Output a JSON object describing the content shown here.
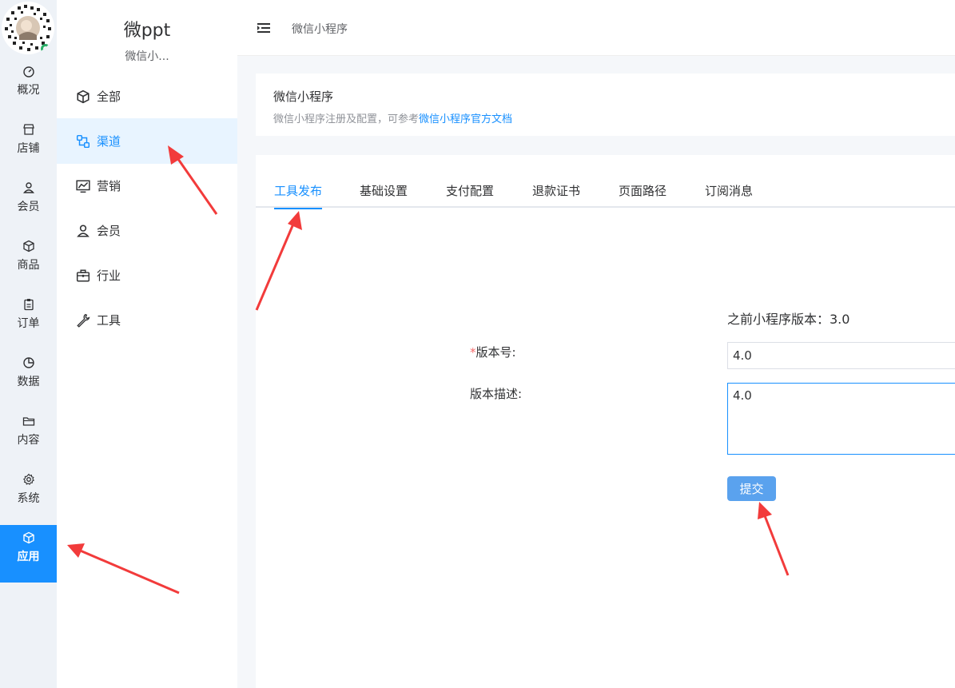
{
  "colors": {
    "accent": "#1890ff",
    "rail_bg": "#eef2f7",
    "active_side_bg": "#e8f4ff",
    "submit_bg": "#5aa2ee",
    "required": "#f56c6c",
    "annotation_arrow": "#f23b3b"
  },
  "rail": {
    "items": [
      {
        "label": "概况",
        "icon": "dashboard-icon"
      },
      {
        "label": "店铺",
        "icon": "store-icon"
      },
      {
        "label": "会员",
        "icon": "user-icon"
      },
      {
        "label": "商品",
        "icon": "box-icon"
      },
      {
        "label": "订单",
        "icon": "clipboard-icon"
      },
      {
        "label": "数据",
        "icon": "pie-chart-icon"
      },
      {
        "label": "内容",
        "icon": "folder-icon"
      },
      {
        "label": "系统",
        "icon": "gear-icon"
      },
      {
        "label": "应用",
        "icon": "cube-icon",
        "active": true
      }
    ]
  },
  "sidebar": {
    "title": "微ppt",
    "subtitle": "微信小...",
    "items": [
      {
        "label": "全部",
        "icon": "cube-icon"
      },
      {
        "label": "渠道",
        "icon": "channel-icon",
        "active": true
      },
      {
        "label": "营销",
        "icon": "trend-chart-icon"
      },
      {
        "label": "会员",
        "icon": "user-icon"
      },
      {
        "label": "行业",
        "icon": "briefcase-icon"
      },
      {
        "label": "工具",
        "icon": "wrench-icon"
      }
    ]
  },
  "header": {
    "menu_icon": "menu-fold-icon",
    "breadcrumb": "微信小程序"
  },
  "info": {
    "title": "微信小程序",
    "desc_prefix": "微信小程序注册及配置，可参考",
    "doc_link": "微信小程序官方文档"
  },
  "tabs": [
    {
      "label": "工具发布",
      "active": true
    },
    {
      "label": "基础设置"
    },
    {
      "label": "支付配置"
    },
    {
      "label": "退款证书"
    },
    {
      "label": "页面路径"
    },
    {
      "label": "订阅消息"
    }
  ],
  "form": {
    "previous_version": "之前小程序版本：3.0",
    "required_mark": "*",
    "version_label": "版本号:",
    "version_value": "4.0",
    "desc_label": "版本描述:",
    "desc_value": "4.0",
    "submit_label": "提交"
  }
}
